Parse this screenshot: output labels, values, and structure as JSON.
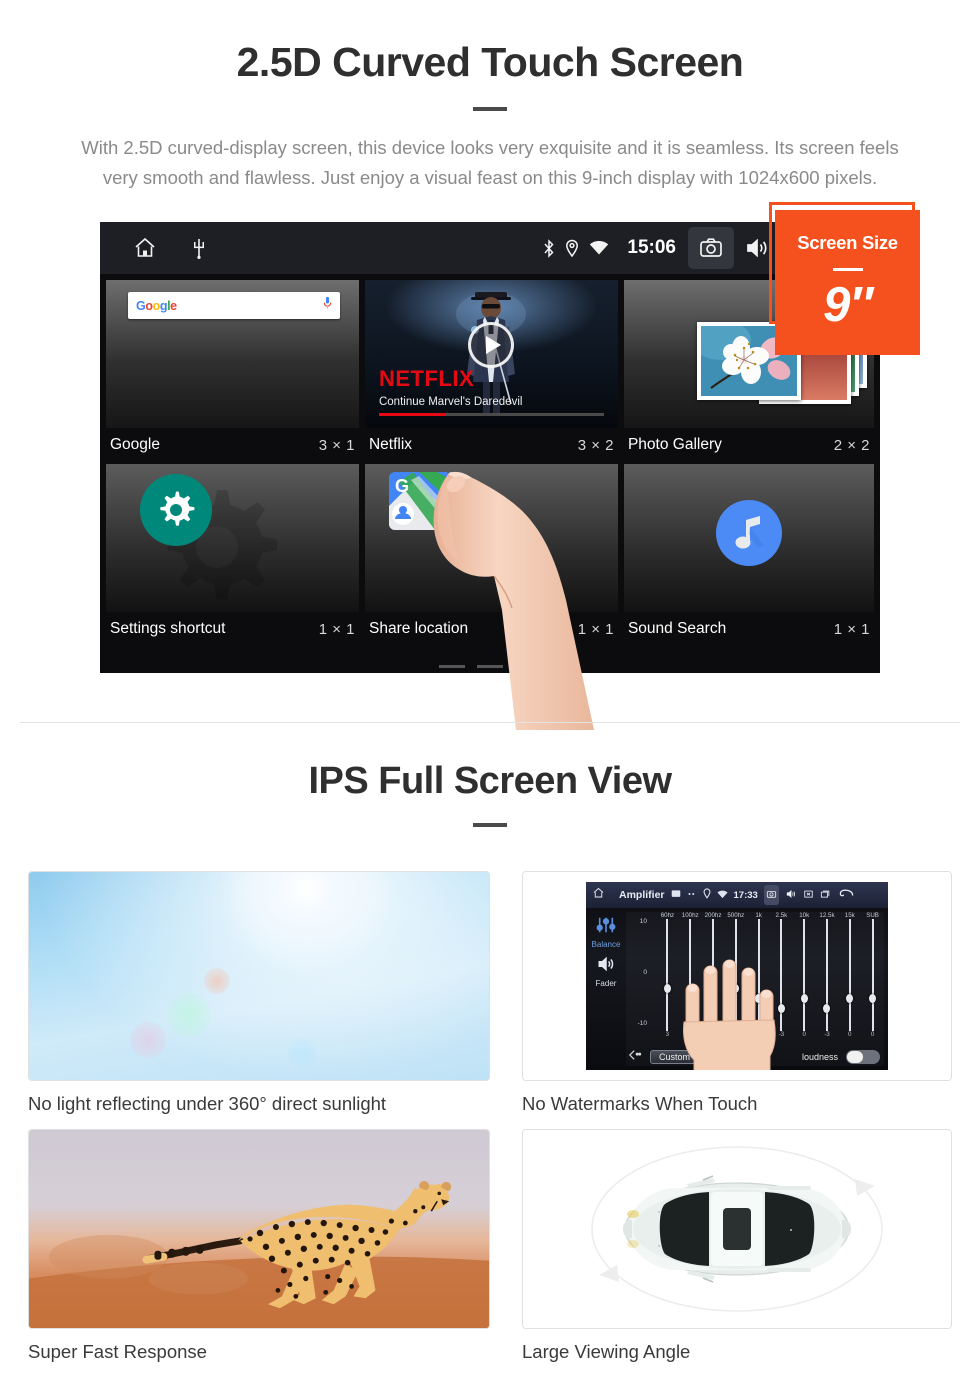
{
  "section1": {
    "headline": "2.5D Curved Touch Screen",
    "lede": "With 2.5D curved-display screen, this device looks very exquisite and it is seamless. Its screen feels very smooth and flawless. Just enjoy a visual feast on this 9-inch display with 1024x600 pixels."
  },
  "badge": {
    "title": "Screen Size",
    "value": "9″"
  },
  "statusbar": {
    "time": "15:06",
    "icons_left": [
      "home-icon",
      "usb-icon"
    ],
    "icons_right": [
      "bluetooth-icon",
      "location-icon",
      "wifi-icon",
      "camera-icon",
      "volume-icon",
      "close-box-icon",
      "recents-icon"
    ]
  },
  "widgets": [
    {
      "name": "Google",
      "dims": "3 × 1",
      "icon": "google-search-widget"
    },
    {
      "name": "Netflix",
      "dims": "3 × 2",
      "icon": "netflix-widget"
    },
    {
      "name": "Photo Gallery",
      "dims": "2 × 2",
      "icon": "photo-gallery-widget"
    },
    {
      "name": "Settings shortcut",
      "dims": "1 × 1",
      "icon": "settings-gear-widget"
    },
    {
      "name": "Share location",
      "dims": "1 × 1",
      "icon": "google-maps-widget"
    },
    {
      "name": "Sound Search",
      "dims": "1 × 1",
      "icon": "sound-search-widget"
    }
  ],
  "google_widget": {
    "logo_letters": [
      "G",
      "o",
      "o",
      "g",
      "l",
      "e"
    ],
    "mic_icon": "microphone-icon"
  },
  "netflix_widget": {
    "brand": "NETFLIX",
    "subtitle": "Continue Marvel's Daredevil",
    "play_icon": "play-icon"
  },
  "pager": {
    "dots": 3,
    "active_index": 2
  },
  "section2": {
    "headline": "IPS Full Screen View"
  },
  "panels": [
    {
      "caption": "No light reflecting under 360° direct sunlight",
      "media": "blue-sky-sunlight-photo"
    },
    {
      "caption": "No Watermarks When Touch",
      "media": "amplifier-equalizer-screenshot"
    },
    {
      "caption": "Super Fast Response",
      "media": "running-cheetah-photo"
    },
    {
      "caption": "Large Viewing Angle",
      "media": "car-top-view-illustration"
    }
  ],
  "amplifier": {
    "title": "Amplifier",
    "time": "17:33",
    "side_labels": [
      "Balance",
      "Fader"
    ],
    "bands": [
      "60hz",
      "100hz",
      "200hz",
      "500hz",
      "1k",
      "2.5k",
      "10k",
      "12.5k",
      "15k",
      "SUB"
    ],
    "values": [
      "3",
      "-4",
      "0",
      "0",
      "0",
      "-3",
      "0",
      "-3",
      "0",
      "0"
    ],
    "scale_top": "10",
    "scale_mid": "0",
    "scale_bottom": "-10",
    "preset_button": "Custom",
    "loudness_label": "loudness",
    "back_icon": "back-arrow-icon"
  },
  "colors": {
    "accent_orange": "#f4511e",
    "netflix_red": "#E50914",
    "settings_teal": "#00897b",
    "sound_blue": "#4c8bf5"
  }
}
